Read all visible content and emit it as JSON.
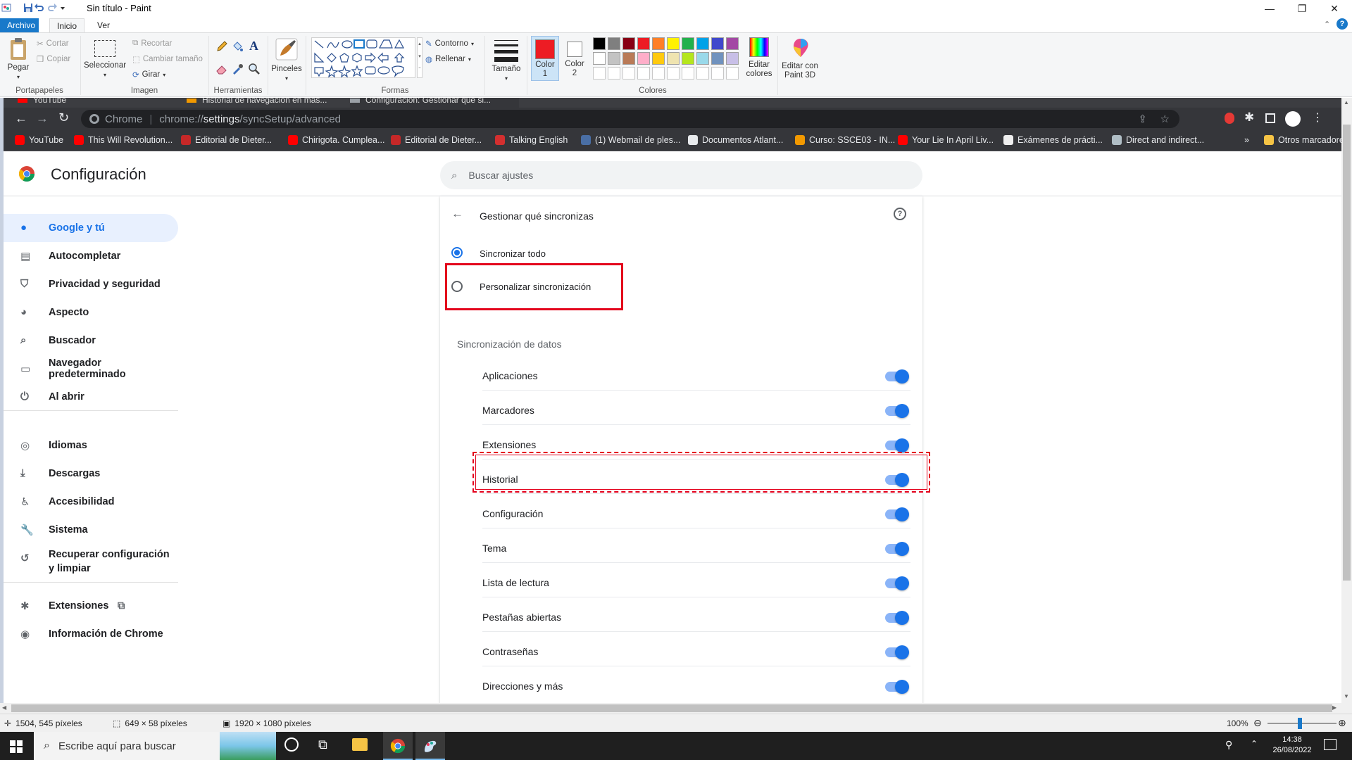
{
  "paint": {
    "window_title": "Sin título - Paint",
    "tabs": [
      "Archivo",
      "Inicio",
      "Ver"
    ],
    "clipboard": {
      "paste": "Pegar",
      "cut": "Cortar",
      "copy": "Copiar",
      "group": "Portapapeles"
    },
    "image": {
      "select": "Seleccionar",
      "crop": "Recortar",
      "resize": "Cambiar tamaño",
      "rotate": "Girar",
      "group": "Imagen"
    },
    "tools": {
      "group": "Herramientas"
    },
    "brushes": {
      "label": "Pinceles"
    },
    "shapes": {
      "outline": "Contorno",
      "fill": "Rellenar",
      "group": "Formas"
    },
    "size": {
      "label": "Tamaño"
    },
    "colors": {
      "color1": "Color 1",
      "color2": "Color 2",
      "edit": "Editar colores",
      "paint3d": "Editar con Paint 3D",
      "group": "Colores",
      "color1_value": "#ed1c24",
      "color2_value": "#ffffff",
      "palette": [
        "#000000",
        "#7f7f7f",
        "#880015",
        "#ed1c24",
        "#ff7f27",
        "#fff200",
        "#22b14c",
        "#00a2e8",
        "#3f48cc",
        "#a349a4",
        "#ffffff",
        "#c3c3c3",
        "#b97a57",
        "#ffaec9",
        "#ffc90e",
        "#efe4b0",
        "#b5e61d",
        "#99d9ea",
        "#7092be",
        "#c8bfe7"
      ]
    },
    "status": {
      "cursor": "1504, 545 píxeles",
      "selection": "649 × 58 píxeles",
      "image_size": "1920 × 1080 píxeles",
      "zoom": "100%"
    }
  },
  "chrome": {
    "tabs": [
      "YouTube",
      "Historial de navegación en más...",
      "Configuración: Gestionar qué si..."
    ],
    "url_site": "Chrome",
    "url_prefix": "chrome://",
    "url_bold": "settings",
    "url_rest": "/syncSetup/advanced",
    "bookmarks": [
      {
        "label": "YouTube",
        "color": "#ff0000"
      },
      {
        "label": "This Will Revolution...",
        "color": "#ff0000"
      },
      {
        "label": "Editorial de Dieter...",
        "color": "#c62828"
      },
      {
        "label": "Chirigota. Cumplea...",
        "color": "#ff0000"
      },
      {
        "label": "Editorial de Dieter...",
        "color": "#c62828"
      },
      {
        "label": "Talking English",
        "color": "#d32f2f"
      },
      {
        "label": "(1) Webmail de ples...",
        "color": "#4a6fa5"
      },
      {
        "label": "Documentos Atlant...",
        "color": "#e8eaed"
      },
      {
        "label": "Curso: SSCE03 - IN...",
        "color": "#f29900"
      },
      {
        "label": "Your Lie In April Liv...",
        "color": "#ff0000"
      },
      {
        "label": "Exámenes de prácti...",
        "color": "#eeeeee"
      },
      {
        "label": "Direct and indirect...",
        "color": "#b0bec5"
      }
    ],
    "bookmarks_more": "»",
    "other_bookmarks": "Otros marcadores"
  },
  "settings": {
    "title": "Configuración",
    "search_placeholder": "Buscar ajustes",
    "nav": [
      {
        "label": "Google y tú",
        "icon": "person-icon"
      },
      {
        "label": "Autocompletar",
        "icon": "clipboard-icon"
      },
      {
        "label": "Privacidad y seguridad",
        "icon": "shield-icon"
      },
      {
        "label": "Aspecto",
        "icon": "palette-icon"
      },
      {
        "label": "Buscador",
        "icon": "search-icon"
      },
      {
        "label": "Navegador predeterminado",
        "icon": "browser-icon"
      },
      {
        "label": "Al abrir",
        "icon": "power-icon"
      },
      {
        "label": "Idiomas",
        "icon": "globe-icon"
      },
      {
        "label": "Descargas",
        "icon": "download-icon"
      },
      {
        "label": "Accesibilidad",
        "icon": "accessibility-icon"
      },
      {
        "label": "Sistema",
        "icon": "wrench-icon"
      },
      {
        "label": "Recuperar configuración y limpiar",
        "icon": "restore-icon"
      },
      {
        "label": "Extensiones",
        "icon": "puzzle-icon"
      },
      {
        "label": "Información de Chrome",
        "icon": "chrome-icon"
      }
    ],
    "sync": {
      "header": "Gestionar qué sincronizas",
      "sync_all": "Sincronizar todo",
      "customize": "Personalizar sincronización",
      "data_header": "Sincronización de datos",
      "items": [
        "Aplicaciones",
        "Marcadores",
        "Extensiones",
        "Historial",
        "Configuración",
        "Tema",
        "Lista de lectura",
        "Pestañas abiertas",
        "Contraseñas",
        "Direcciones y más"
      ]
    }
  },
  "taskbar": {
    "search_placeholder": "Escribe aquí para buscar",
    "time": "14:38",
    "date": "26/08/2022"
  }
}
